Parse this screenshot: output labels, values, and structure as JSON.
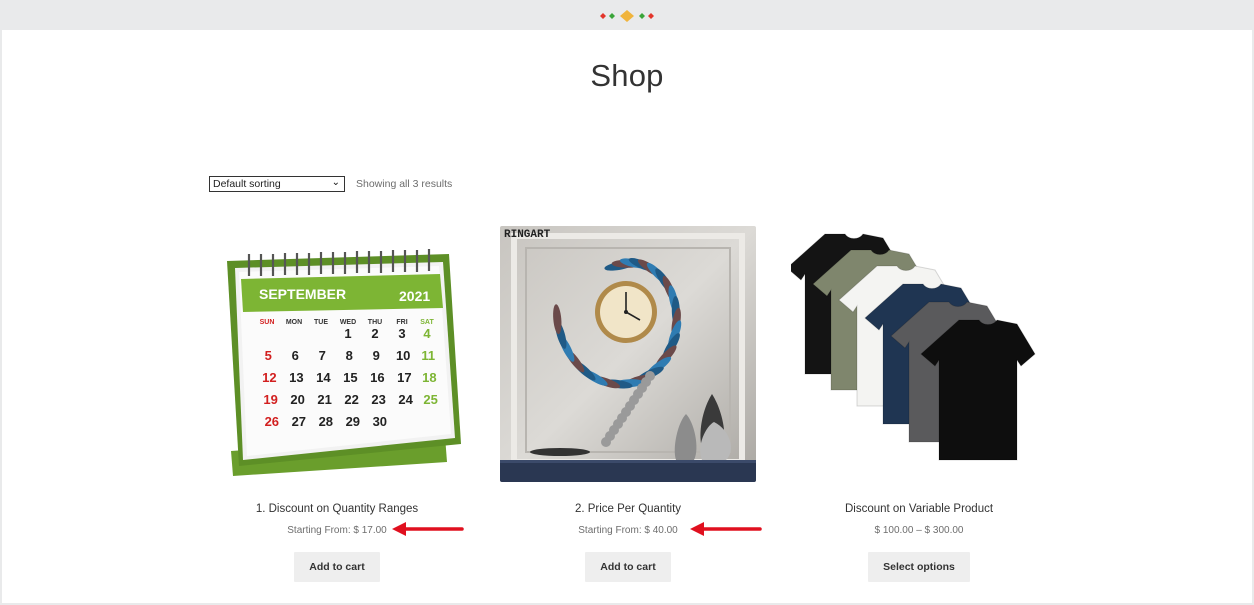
{
  "page": {
    "title": "Shop"
  },
  "toolbar": {
    "sorting_value": "Default sorting",
    "result_count": "Showing all 3 results"
  },
  "products": [
    {
      "name": "1. Discount on Quantity Ranges",
      "price": "Starting From: $ 17.00",
      "button": "Add to cart",
      "image": "calendar-image",
      "calendar": {
        "month": "SEPTEMBER",
        "year": "2021",
        "days": [
          "SUN",
          "MON",
          "TUE",
          "WED",
          "THU",
          "FRI",
          "SAT"
        ],
        "weeks": [
          [
            "",
            "",
            "",
            "1",
            "2",
            "3",
            "4"
          ],
          [
            "5",
            "6",
            "7",
            "8",
            "9",
            "10",
            "11"
          ],
          [
            "12",
            "13",
            "14",
            "15",
            "16",
            "17",
            "18"
          ],
          [
            "19",
            "20",
            "21",
            "22",
            "23",
            "24",
            "25"
          ],
          [
            "26",
            "27",
            "28",
            "29",
            "30",
            "",
            ""
          ]
        ]
      }
    },
    {
      "name": "2. Price Per Quantity",
      "price": "Starting From: $ 40.00",
      "button": "Add to cart",
      "image": "wall-clock-image",
      "watermark": "RINGART"
    },
    {
      "name": "Discount on Variable Product",
      "price": "$ 100.00 – $ 300.00",
      "button": "Select options",
      "image": "tshirts-image"
    }
  ],
  "colors": {
    "arrow": "#e0101f",
    "button_bg": "#eeeeee",
    "calendar_green": "#7db534",
    "calendar_red": "#d21f1f"
  }
}
